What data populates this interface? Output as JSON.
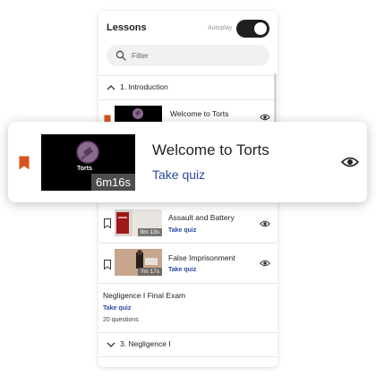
{
  "panel": {
    "title": "Lessons",
    "autoplay_label": "Autoplay",
    "autoplay_on": true,
    "filter_placeholder": "Filter"
  },
  "sections": [
    {
      "label": "1. Introduction",
      "expanded": true
    },
    {
      "label": "3. Negligence I",
      "expanded": false
    }
  ],
  "lessons": [
    {
      "title": "Welcome to Torts",
      "thumb_label": "Torts",
      "bookmarked": true,
      "bookmark_color": "#d9541e"
    },
    {
      "title": "Assault and Battery",
      "duration": "9m 13s",
      "quiz": "Take quiz",
      "bookmarked": false
    },
    {
      "title": "False Imprisonment",
      "duration": "7m 17s",
      "quiz": "Take quiz",
      "bookmarked": false
    }
  ],
  "exam": {
    "title": "Negligence I Final Exam",
    "quiz": "Take quiz",
    "questions": "20 questions"
  },
  "overlay": {
    "title": "Welcome to Torts",
    "duration": "6m16s",
    "thumb_label": "Torts",
    "quiz": "Take quiz",
    "bookmark_color": "#d9541e",
    "link_color": "#2b4aa0"
  }
}
